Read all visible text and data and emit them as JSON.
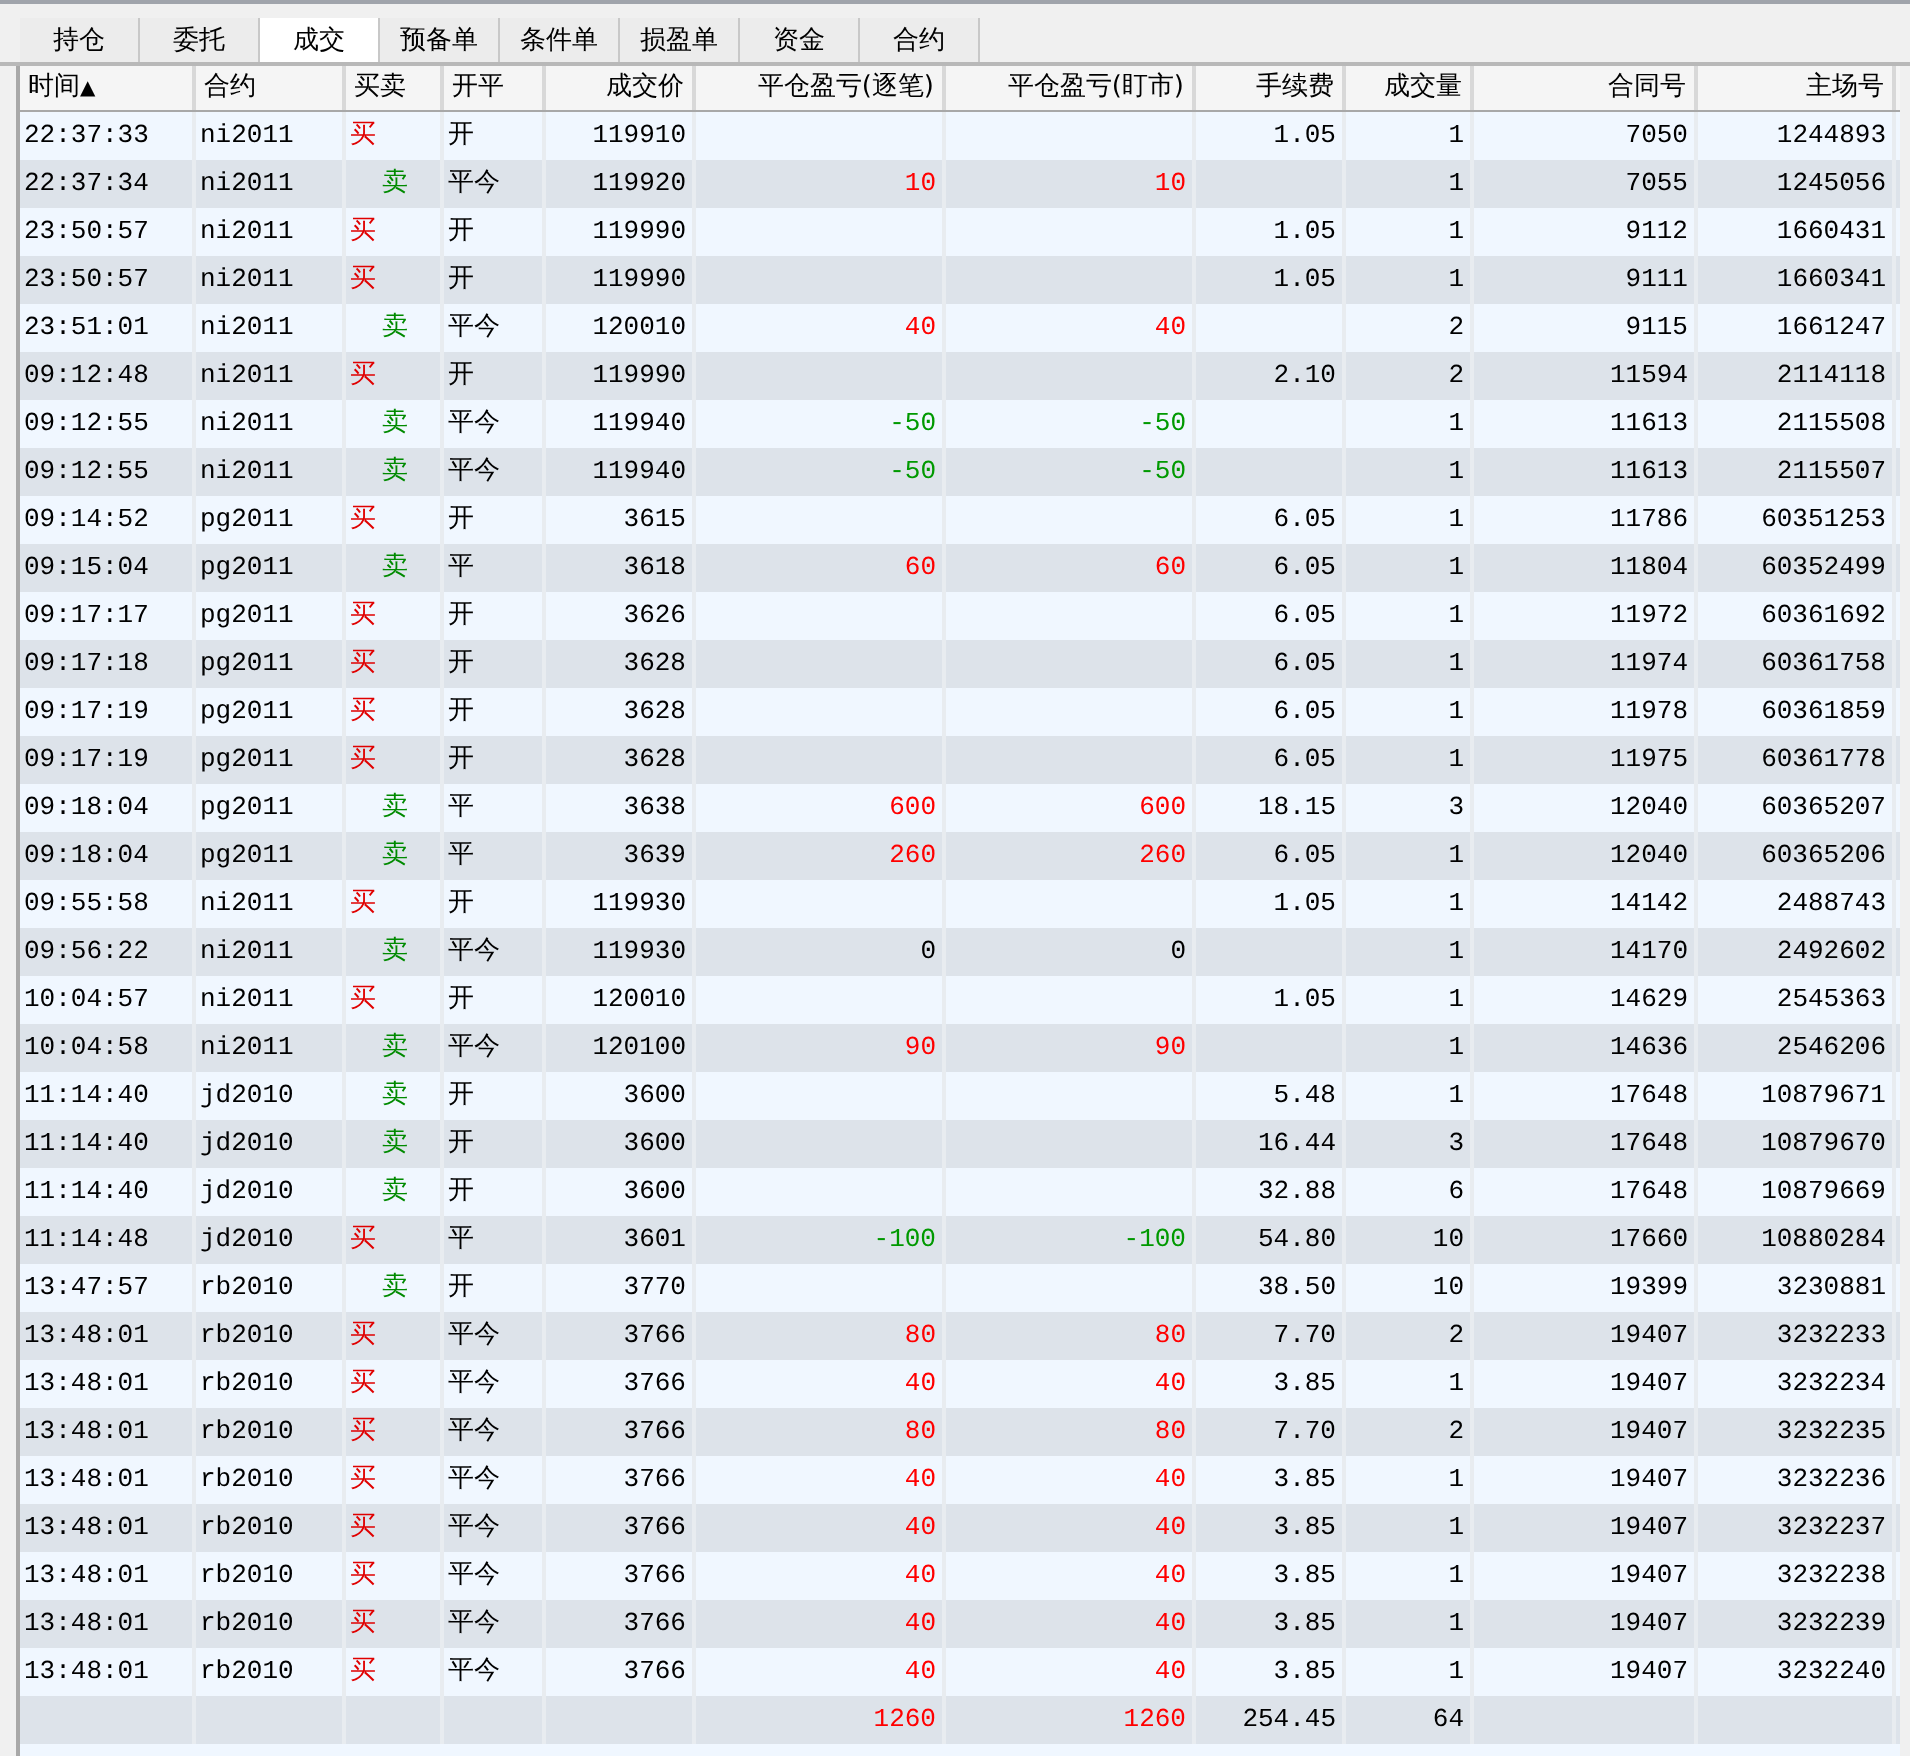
{
  "tabs": [
    {
      "label": "持仓",
      "selected": false
    },
    {
      "label": "委托",
      "selected": false
    },
    {
      "label": "成交",
      "selected": true
    },
    {
      "label": "预备单",
      "selected": false
    },
    {
      "label": "条件单",
      "selected": false
    },
    {
      "label": "损盈单",
      "selected": false
    },
    {
      "label": "资金",
      "selected": false
    },
    {
      "label": "合约",
      "selected": false
    }
  ],
  "columns": [
    {
      "label": "时间",
      "sort_indicator": "▲"
    },
    {
      "label": "合约"
    },
    {
      "label": "买卖"
    },
    {
      "label": "开平"
    },
    {
      "label": "成交价"
    },
    {
      "label": "平仓盈亏(逐笔)"
    },
    {
      "label": "平仓盈亏(盯市)"
    },
    {
      "label": "手续费"
    },
    {
      "label": "成交量"
    },
    {
      "label": "合同号"
    },
    {
      "label": "主场号"
    }
  ],
  "rows": [
    {
      "time": "22:37:33",
      "contract": "ni2011",
      "side": "买",
      "kind": "buy",
      "open_close": "开",
      "price": "119910",
      "fee": "1.05",
      "volume": "1",
      "contract_no": "7050",
      "exchange_no": "1244893"
    },
    {
      "time": "22:37:34",
      "contract": "ni2011",
      "side": "卖",
      "kind": "sell",
      "open_close": "平今",
      "price": "119920",
      "pnl_trade": "10",
      "pnl_mark": "10",
      "color": "#ff0000",
      "volume": "1",
      "contract_no": "7055",
      "exchange_no": "1245056"
    },
    {
      "time": "23:50:57",
      "contract": "ni2011",
      "side": "买",
      "kind": "buy",
      "open_close": "开",
      "price": "119990",
      "fee": "1.05",
      "volume": "1",
      "contract_no": "9112",
      "exchange_no": "1660431"
    },
    {
      "time": "23:50:57",
      "contract": "ni2011",
      "side": "买",
      "kind": "buy",
      "open_close": "开",
      "price": "119990",
      "fee": "1.05",
      "volume": "1",
      "contract_no": "9111",
      "exchange_no": "1660341"
    },
    {
      "time": "23:51:01",
      "contract": "ni2011",
      "side": "卖",
      "kind": "sell",
      "open_close": "平今",
      "price": "120010",
      "pnl_trade": "40",
      "pnl_mark": "40",
      "color": "#ff0000",
      "volume": "2",
      "contract_no": "9115",
      "exchange_no": "1661247"
    },
    {
      "time": "09:12:48",
      "contract": "ni2011",
      "side": "买",
      "kind": "buy",
      "open_close": "开",
      "price": "119990",
      "fee": "2.10",
      "volume": "2",
      "contract_no": "11594",
      "exchange_no": "2114118"
    },
    {
      "time": "09:12:55",
      "contract": "ni2011",
      "side": "卖",
      "kind": "sell",
      "open_close": "平今",
      "price": "119940",
      "pnl_trade": "-50",
      "pnl_mark": "-50",
      "color": "#009900",
      "volume": "1",
      "contract_no": "11613",
      "exchange_no": "2115508"
    },
    {
      "time": "09:12:55",
      "contract": "ni2011",
      "side": "卖",
      "kind": "sell",
      "open_close": "平今",
      "price": "119940",
      "pnl_trade": "-50",
      "pnl_mark": "-50",
      "color": "#009900",
      "volume": "1",
      "contract_no": "11613",
      "exchange_no": "2115507"
    },
    {
      "time": "09:14:52",
      "contract": "pg2011",
      "side": "买",
      "kind": "buy",
      "open_close": "开",
      "price": "3615",
      "fee": "6.05",
      "volume": "1",
      "contract_no": "11786",
      "exchange_no": "60351253"
    },
    {
      "time": "09:15:04",
      "contract": "pg2011",
      "side": "卖",
      "kind": "sell",
      "open_close": "平",
      "price": "3618",
      "pnl_trade": "60",
      "pnl_mark": "60",
      "color": "#ff0000",
      "fee": "6.05",
      "volume": "1",
      "contract_no": "11804",
      "exchange_no": "60352499"
    },
    {
      "time": "09:17:17",
      "contract": "pg2011",
      "side": "买",
      "kind": "buy",
      "open_close": "开",
      "price": "3626",
      "fee": "6.05",
      "volume": "1",
      "contract_no": "11972",
      "exchange_no": "60361692"
    },
    {
      "time": "09:17:18",
      "contract": "pg2011",
      "side": "买",
      "kind": "buy",
      "open_close": "开",
      "price": "3628",
      "fee": "6.05",
      "volume": "1",
      "contract_no": "11974",
      "exchange_no": "60361758"
    },
    {
      "time": "09:17:19",
      "contract": "pg2011",
      "side": "买",
      "kind": "buy",
      "open_close": "开",
      "price": "3628",
      "fee": "6.05",
      "volume": "1",
      "contract_no": "11978",
      "exchange_no": "60361859"
    },
    {
      "time": "09:17:19",
      "contract": "pg2011",
      "side": "买",
      "kind": "buy",
      "open_close": "开",
      "price": "3628",
      "fee": "6.05",
      "volume": "1",
      "contract_no": "11975",
      "exchange_no": "60361778"
    },
    {
      "time": "09:18:04",
      "contract": "pg2011",
      "side": "卖",
      "kind": "sell",
      "open_close": "平",
      "price": "3638",
      "pnl_trade": "600",
      "pnl_mark": "600",
      "color": "#ff0000",
      "fee": "18.15",
      "volume": "3",
      "contract_no": "12040",
      "exchange_no": "60365207"
    },
    {
      "time": "09:18:04",
      "contract": "pg2011",
      "side": "卖",
      "kind": "sell",
      "open_close": "平",
      "price": "3639",
      "pnl_trade": "260",
      "pnl_mark": "260",
      "color": "#ff0000",
      "fee": "6.05",
      "volume": "1",
      "contract_no": "12040",
      "exchange_no": "60365206"
    },
    {
      "time": "09:55:58",
      "contract": "ni2011",
      "side": "买",
      "kind": "buy",
      "open_close": "开",
      "price": "119930",
      "fee": "1.05",
      "volume": "1",
      "contract_no": "14142",
      "exchange_no": "2488743"
    },
    {
      "time": "09:56:22",
      "contract": "ni2011",
      "side": "卖",
      "kind": "sell",
      "open_close": "平今",
      "price": "119930",
      "pnl_trade": "0",
      "pnl_mark": "0",
      "color": "#000000",
      "volume": "1",
      "contract_no": "14170",
      "exchange_no": "2492602"
    },
    {
      "time": "10:04:57",
      "contract": "ni2011",
      "side": "买",
      "kind": "buy",
      "open_close": "开",
      "price": "120010",
      "fee": "1.05",
      "volume": "1",
      "contract_no": "14629",
      "exchange_no": "2545363"
    },
    {
      "time": "10:04:58",
      "contract": "ni2011",
      "side": "卖",
      "kind": "sell",
      "open_close": "平今",
      "price": "120100",
      "pnl_trade": "90",
      "pnl_mark": "90",
      "color": "#ff0000",
      "volume": "1",
      "contract_no": "14636",
      "exchange_no": "2546206"
    },
    {
      "time": "11:14:40",
      "contract": "jd2010",
      "side": "卖",
      "kind": "sell",
      "open_close": "开",
      "price": "3600",
      "fee": "5.48",
      "volume": "1",
      "contract_no": "17648",
      "exchange_no": "10879671"
    },
    {
      "time": "11:14:40",
      "contract": "jd2010",
      "side": "卖",
      "kind": "sell",
      "open_close": "开",
      "price": "3600",
      "fee": "16.44",
      "volume": "3",
      "contract_no": "17648",
      "exchange_no": "10879670"
    },
    {
      "time": "11:14:40",
      "contract": "jd2010",
      "side": "卖",
      "kind": "sell",
      "open_close": "开",
      "price": "3600",
      "fee": "32.88",
      "volume": "6",
      "contract_no": "17648",
      "exchange_no": "10879669"
    },
    {
      "time": "11:14:48",
      "contract": "jd2010",
      "side": "买",
      "kind": "buy",
      "open_close": "平",
      "price": "3601",
      "pnl_trade": "-100",
      "pnl_mark": "-100",
      "color": "#009900",
      "fee": "54.80",
      "volume": "10",
      "contract_no": "17660",
      "exchange_no": "10880284"
    },
    {
      "time": "13:47:57",
      "contract": "rb2010",
      "side": "卖",
      "kind": "sell",
      "open_close": "开",
      "price": "3770",
      "fee": "38.50",
      "volume": "10",
      "contract_no": "19399",
      "exchange_no": "3230881"
    },
    {
      "time": "13:48:01",
      "contract": "rb2010",
      "side": "买",
      "kind": "buy",
      "open_close": "平今",
      "price": "3766",
      "pnl_trade": "80",
      "pnl_mark": "80",
      "color": "#ff0000",
      "fee": "7.70",
      "volume": "2",
      "contract_no": "19407",
      "exchange_no": "3232233"
    },
    {
      "time": "13:48:01",
      "contract": "rb2010",
      "side": "买",
      "kind": "buy",
      "open_close": "平今",
      "price": "3766",
      "pnl_trade": "40",
      "pnl_mark": "40",
      "color": "#ff0000",
      "fee": "3.85",
      "volume": "1",
      "contract_no": "19407",
      "exchange_no": "3232234"
    },
    {
      "time": "13:48:01",
      "contract": "rb2010",
      "side": "买",
      "kind": "buy",
      "open_close": "平今",
      "price": "3766",
      "pnl_trade": "80",
      "pnl_mark": "80",
      "color": "#ff0000",
      "fee": "7.70",
      "volume": "2",
      "contract_no": "19407",
      "exchange_no": "3232235"
    },
    {
      "time": "13:48:01",
      "contract": "rb2010",
      "side": "买",
      "kind": "buy",
      "open_close": "平今",
      "price": "3766",
      "pnl_trade": "40",
      "pnl_mark": "40",
      "color": "#ff0000",
      "fee": "3.85",
      "volume": "1",
      "contract_no": "19407",
      "exchange_no": "3232236"
    },
    {
      "time": "13:48:01",
      "contract": "rb2010",
      "side": "买",
      "kind": "buy",
      "open_close": "平今",
      "price": "3766",
      "pnl_trade": "40",
      "pnl_mark": "40",
      "color": "#ff0000",
      "fee": "3.85",
      "volume": "1",
      "contract_no": "19407",
      "exchange_no": "3232237"
    },
    {
      "time": "13:48:01",
      "contract": "rb2010",
      "side": "买",
      "kind": "buy",
      "open_close": "平今",
      "price": "3766",
      "pnl_trade": "40",
      "pnl_mark": "40",
      "color": "#ff0000",
      "fee": "3.85",
      "volume": "1",
      "contract_no": "19407",
      "exchange_no": "3232238"
    },
    {
      "time": "13:48:01",
      "contract": "rb2010",
      "side": "买",
      "kind": "buy",
      "open_close": "平今",
      "price": "3766",
      "pnl_trade": "40",
      "pnl_mark": "40",
      "color": "#ff0000",
      "fee": "3.85",
      "volume": "1",
      "contract_no": "19407",
      "exchange_no": "3232239"
    },
    {
      "time": "13:48:01",
      "contract": "rb2010",
      "side": "买",
      "kind": "buy",
      "open_close": "平今",
      "price": "3766",
      "pnl_trade": "40",
      "pnl_mark": "40",
      "color": "#ff0000",
      "fee": "3.85",
      "volume": "1",
      "contract_no": "19407",
      "exchange_no": "3232240"
    }
  ],
  "totals": {
    "pnl_trade": "1260",
    "pnl_mark": "1260",
    "color": "#ff0000",
    "fee": "254.45",
    "volume": "64"
  }
}
